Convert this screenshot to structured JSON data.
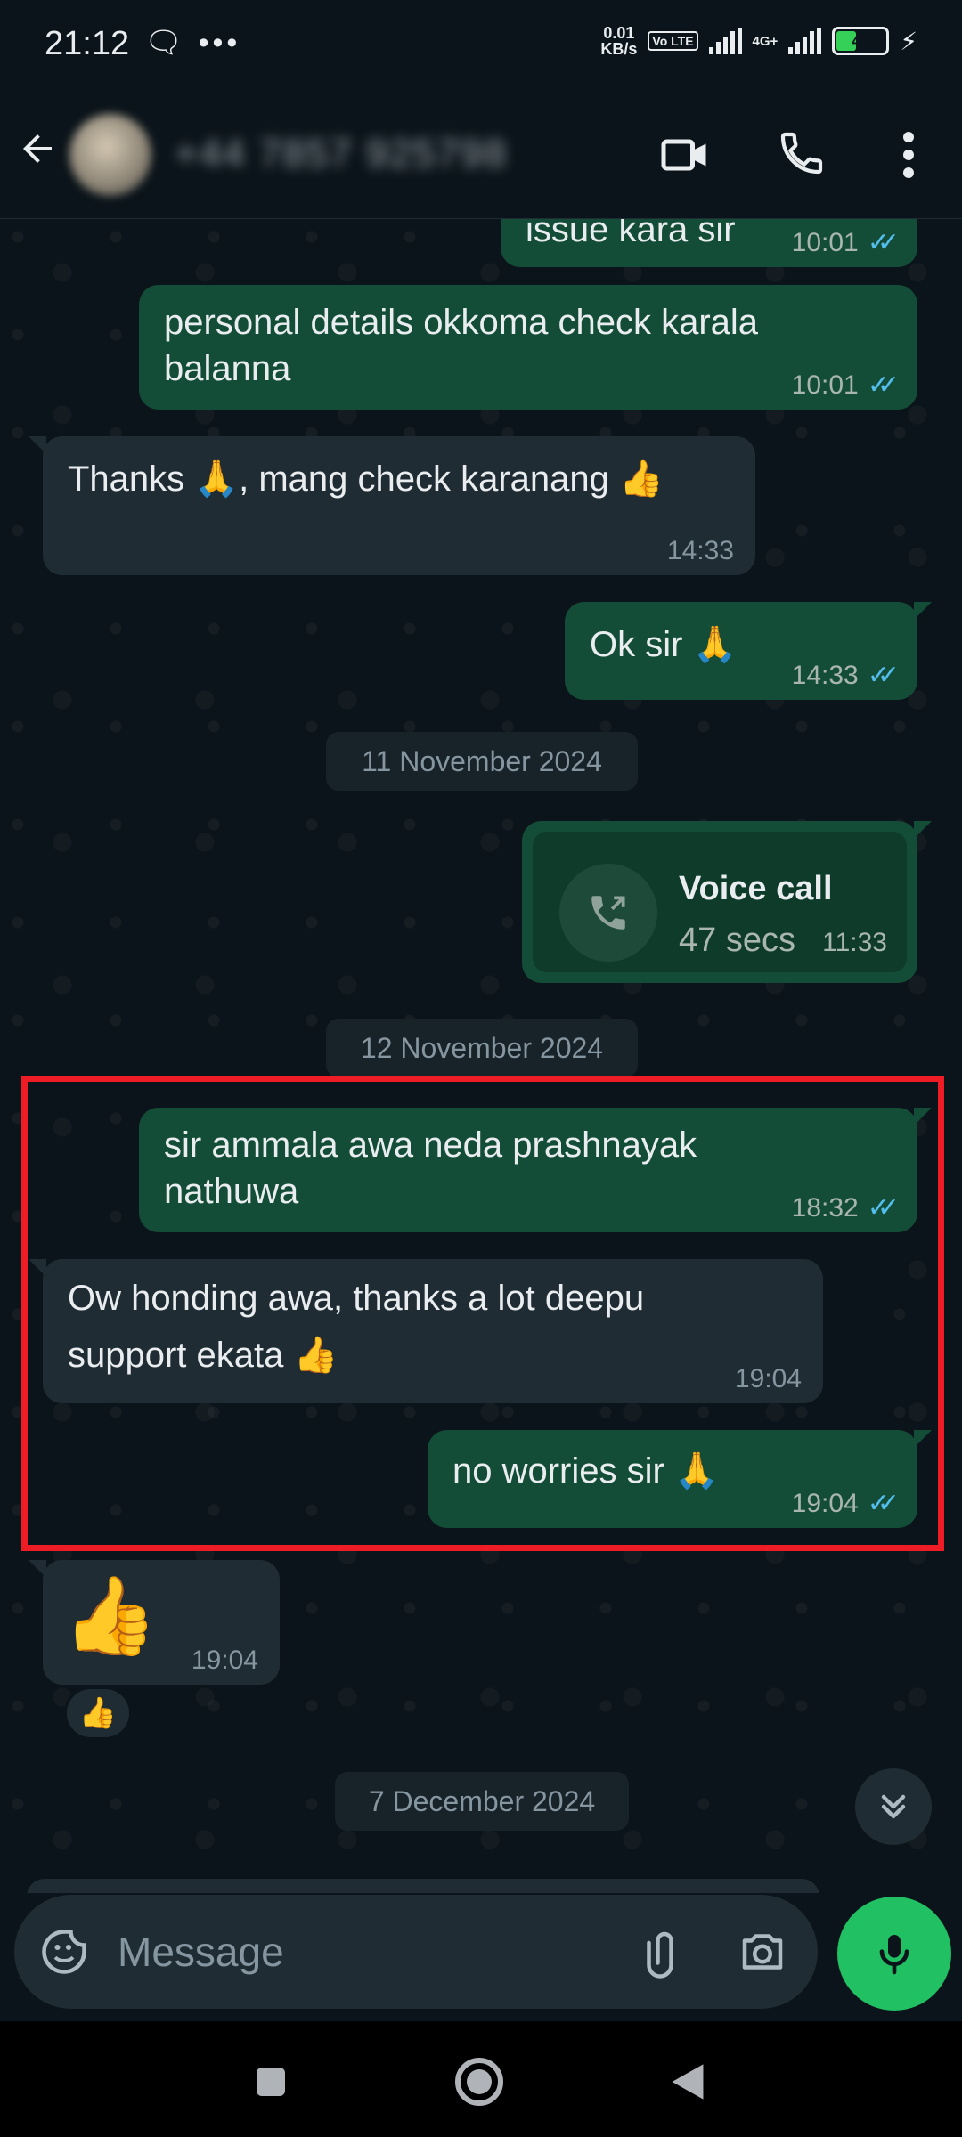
{
  "status_bar": {
    "time": "21:12",
    "left_icons": "🗨 •••",
    "net_speed_value": "0.01",
    "net_speed_unit": "KB/s",
    "volte": "Vo LTE",
    "network_type": "4G+",
    "battery_level": "44",
    "battery_fraction": 0.44,
    "charging_icon": "⚡"
  },
  "header": {
    "contact_name": "+44 7857 925798",
    "icons": [
      "back-arrow-icon",
      "video-call-icon",
      "voice-call-icon",
      "more-options-icon"
    ]
  },
  "messages": [
    {
      "direction": "out",
      "text": "issue kara sir",
      "time": "10:01",
      "read": true
    },
    {
      "direction": "out",
      "text": "personal details okkoma check karala balanna",
      "time": "10:01",
      "read": true
    },
    {
      "direction": "in",
      "text": "Thanks 🙏, mang check karanang 👍",
      "time": "14:33"
    },
    {
      "direction": "out",
      "text": "Ok sir 🙏",
      "time": "14:33",
      "read": true
    },
    {
      "direction": "out",
      "text": "sir ammala awa neda prashnayak nathuwa",
      "time": "18:32",
      "read": true
    },
    {
      "direction": "in",
      "text": "Ow honding awa, thanks a lot deepu support ekata 👍",
      "time": "19:04"
    },
    {
      "direction": "out",
      "text": "no worries sir 🙏",
      "time": "19:04",
      "read": true
    },
    {
      "direction": "in",
      "text": "👍",
      "time": "19:04",
      "reaction": "👍"
    }
  ],
  "call": {
    "title": "Voice call",
    "duration": "47 secs",
    "time": "11:33"
  },
  "dates": [
    "11 November 2024",
    "12 November 2024",
    "7 December 2024"
  ],
  "ticks": "✓✓",
  "composer": {
    "placeholder": "Message"
  },
  "colors": {
    "background": "#0b141a",
    "outgoing_bubble": "#144d37",
    "incoming_bubble": "#202c33",
    "read_ticks": "#53bdeb",
    "mic_button": "#21c063",
    "highlight_box": "#ee1c24"
  }
}
